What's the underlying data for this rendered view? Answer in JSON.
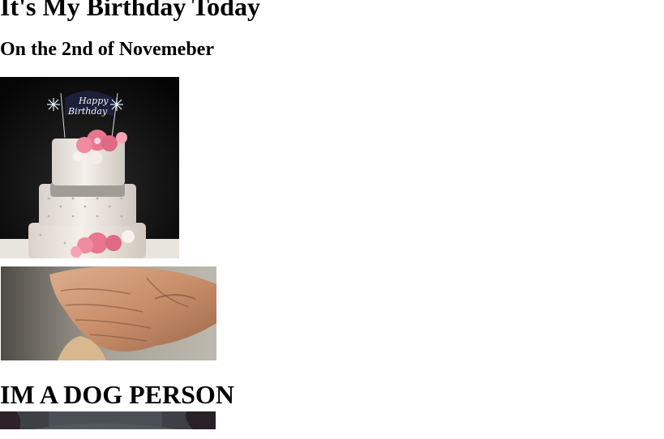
{
  "page": {
    "title": "It's My Birthday Today",
    "subtitle": "On the 2nd of Novemeber",
    "dog_heading": "IM A DOG PERSON"
  },
  "images": {
    "cake": {
      "topper_text_line1": "Happy",
      "topper_text_line2": "Birthday",
      "icon": "birthday-cake"
    },
    "hands": {
      "icon": "hands-petting-dog"
    },
    "dog": {
      "icon": "dog-photo"
    }
  },
  "colors": {
    "text": "#000000",
    "background": "#ffffff"
  }
}
